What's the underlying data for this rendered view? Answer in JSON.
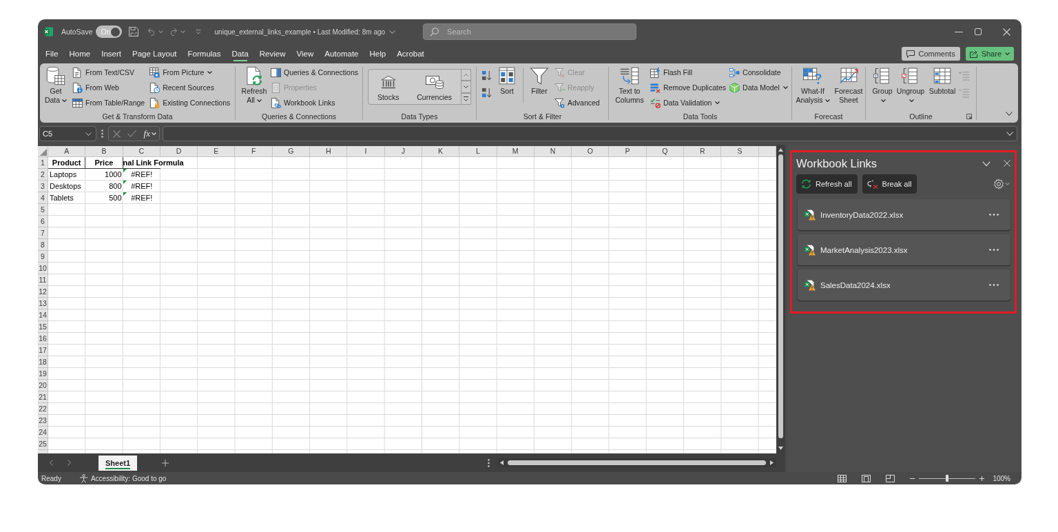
{
  "title_bar": {
    "autosave": {
      "label": "AutoSave",
      "toggle": "On",
      "on": true
    },
    "document_title": "unique_external_links_example • Last Modified: 8m ago",
    "search": {
      "placeholder": "Search"
    }
  },
  "menu": {
    "tabs": [
      {
        "label": "File",
        "selected": false
      },
      {
        "label": "Home",
        "selected": false
      },
      {
        "label": "Insert",
        "selected": false
      },
      {
        "label": "Page Layout",
        "selected": false
      },
      {
        "label": "Formulas",
        "selected": false
      },
      {
        "label": "Data",
        "selected": true
      },
      {
        "label": "Review",
        "selected": false
      },
      {
        "label": "View",
        "selected": false
      },
      {
        "label": "Automate",
        "selected": false
      },
      {
        "label": "Help",
        "selected": false
      },
      {
        "label": "Acrobat",
        "selected": false
      }
    ],
    "comments_button": "Comments",
    "share_button": "Share"
  },
  "ribbon": {
    "groups": [
      {
        "label": "Get & Transform Data",
        "dialog_launcher": false,
        "items": [
          {
            "kind": "large",
            "label": "Get Data",
            "dropdown": true,
            "disabled": false
          },
          {
            "kind": "column",
            "buttons": [
              {
                "label": "From Text/CSV",
                "dropdown": false,
                "disabled": false
              },
              {
                "label": "From Web",
                "dropdown": false,
                "disabled": false
              },
              {
                "label": "From Table/Range",
                "dropdown": false,
                "disabled": false
              }
            ]
          },
          {
            "kind": "column",
            "buttons": [
              {
                "label": "From Picture",
                "dropdown": true,
                "disabled": false
              },
              {
                "label": "Recent Sources",
                "dropdown": false,
                "disabled": false
              },
              {
                "label": "Existing Connections",
                "dropdown": false,
                "disabled": false
              }
            ]
          }
        ]
      },
      {
        "label": "Queries & Connections",
        "dialog_launcher": false,
        "items": [
          {
            "kind": "large",
            "label": "Refresh All",
            "dropdown": true,
            "disabled": false
          },
          {
            "kind": "column",
            "buttons": [
              {
                "label": "Queries & Connections",
                "dropdown": false,
                "disabled": false
              },
              {
                "label": "Properties",
                "dropdown": false,
                "disabled": true
              },
              {
                "label": "Workbook Links",
                "dropdown": false,
                "disabled": false
              }
            ]
          }
        ]
      },
      {
        "label": "Data Types",
        "dialog_launcher": false,
        "items": [
          {
            "kind": "gallery",
            "options": [
              "Stocks",
              "Currencies"
            ]
          }
        ]
      },
      {
        "label": "Sort & Filter",
        "dialog_launcher": false,
        "items": [
          {
            "kind": "icon_column",
            "buttons": [
              {
                "disabled": false
              },
              {
                "disabled": false
              }
            ]
          },
          {
            "kind": "large",
            "label": "Sort",
            "dropdown": false,
            "disabled": false
          },
          {
            "kind": "large",
            "label": "Filter",
            "dropdown": false,
            "disabled": false
          },
          {
            "kind": "column",
            "buttons": [
              {
                "label": "Clear",
                "dropdown": false,
                "disabled": true
              },
              {
                "label": "Reapply",
                "dropdown": false,
                "disabled": true
              },
              {
                "label": "Advanced",
                "dropdown": false,
                "disabled": false
              }
            ]
          }
        ]
      },
      {
        "label": "Data Tools",
        "dialog_launcher": false,
        "items": [
          {
            "kind": "large",
            "label": "Text to Columns",
            "dropdown": false,
            "disabled": false
          },
          {
            "kind": "column",
            "buttons": [
              {
                "label": "Flash Fill",
                "dropdown": false,
                "disabled": false
              },
              {
                "label": "Remove Duplicates",
                "dropdown": false,
                "disabled": false
              },
              {
                "label": "Data Validation",
                "dropdown": true,
                "disabled": false
              }
            ]
          },
          {
            "kind": "column",
            "buttons": [
              {
                "label": "Consolidate",
                "dropdown": false,
                "disabled": false
              },
              {
                "label": "Data Model",
                "dropdown": true,
                "disabled": false
              }
            ]
          }
        ]
      },
      {
        "label": "Forecast",
        "dialog_launcher": false,
        "items": [
          {
            "kind": "large",
            "label": "What-If Analysis",
            "dropdown": true,
            "disabled": false
          },
          {
            "kind": "large",
            "label": "Forecast Sheet",
            "dropdown": false,
            "disabled": false
          }
        ]
      },
      {
        "label": "Outline",
        "dialog_launcher": true,
        "items": [
          {
            "kind": "large",
            "label": "Group",
            "dropdown": true,
            "disabled": false
          },
          {
            "kind": "large",
            "label": "Ungroup",
            "dropdown": true,
            "disabled": false
          },
          {
            "kind": "large",
            "label": "Subtotal",
            "dropdown": false,
            "disabled": false
          },
          {
            "kind": "icon_column",
            "buttons": [
              {
                "disabled": true
              },
              {
                "disabled": true
              }
            ]
          }
        ]
      }
    ]
  },
  "formula_bar": {
    "name_box": "C5",
    "function_button": "fx"
  },
  "sheet": {
    "columns": [
      "A",
      "B",
      "C",
      "D",
      "E",
      "F",
      "G",
      "H",
      "I",
      "J",
      "K",
      "L",
      "M",
      "N",
      "O",
      "P",
      "Q",
      "R",
      "S"
    ],
    "rows": [
      {
        "number": "1",
        "cells": [
          {
            "kind": "header",
            "text": "Product"
          },
          {
            "kind": "header",
            "text": "Price"
          },
          {
            "kind": "overflow_header",
            "text": "nal Link Formula"
          }
        ]
      },
      {
        "number": "2",
        "cells": [
          {
            "kind": "text",
            "text": "Laptops"
          },
          {
            "kind": "number",
            "text": "1000"
          },
          {
            "kind": "error",
            "text": "#REF!"
          }
        ]
      },
      {
        "number": "3",
        "cells": [
          {
            "kind": "text",
            "text": "Desktops"
          },
          {
            "kind": "number",
            "text": "800"
          },
          {
            "kind": "error",
            "text": "#REF!"
          }
        ]
      },
      {
        "number": "4",
        "cells": [
          {
            "kind": "text",
            "text": "Tablets"
          },
          {
            "kind": "number",
            "text": "500"
          },
          {
            "kind": "error",
            "text": "#REF!"
          }
        ]
      },
      {
        "number": "5"
      },
      {
        "number": "6"
      },
      {
        "number": "7"
      },
      {
        "number": "8"
      },
      {
        "number": "9"
      },
      {
        "number": "10"
      },
      {
        "number": "11"
      },
      {
        "number": "12"
      },
      {
        "number": "13"
      },
      {
        "number": "14"
      },
      {
        "number": "15"
      },
      {
        "number": "16"
      },
      {
        "number": "17"
      },
      {
        "number": "18"
      },
      {
        "number": "19"
      },
      {
        "number": "20"
      },
      {
        "number": "21"
      },
      {
        "number": "22"
      },
      {
        "number": "23"
      },
      {
        "number": "24"
      },
      {
        "number": "25"
      }
    ]
  },
  "sheet_tabs": [
    {
      "label": "Sheet1",
      "selected": true
    }
  ],
  "workbook_links": {
    "title": "Workbook Links",
    "buttons": [
      "Refresh all",
      "Break all"
    ],
    "links": [
      {
        "name": "InventoryData2022.xlsx"
      },
      {
        "name": "MarketAnalysis2023.xlsx"
      },
      {
        "name": "SalesData2024.xlsx"
      }
    ]
  },
  "status_bar": {
    "status": "Ready",
    "accessibility": "Accessibility: Good to go",
    "zoom": {
      "level": 0.5,
      "label": "100%"
    }
  }
}
